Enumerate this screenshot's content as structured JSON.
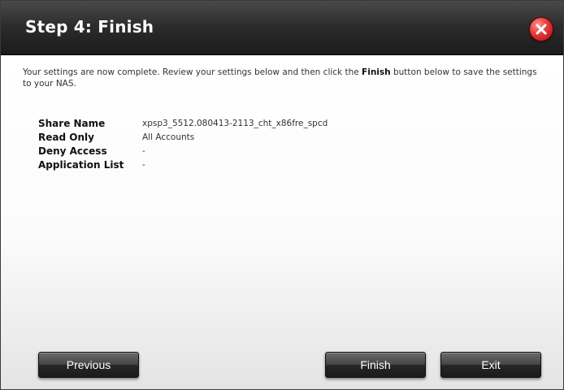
{
  "dialog": {
    "title": "Step 4: Finish",
    "close_icon": "close-icon",
    "close_color": "#e23a3a"
  },
  "intro": {
    "before": "Your settings are now complete. Review your settings below and then click the ",
    "bold": "Finish",
    "after": " button below to save the settings to your NAS."
  },
  "summary": [
    {
      "label": "Share Name",
      "value": "xpsp3_5512.080413-2113_cht_x86fre_spcd"
    },
    {
      "label": "Read Only",
      "value": "All Accounts"
    },
    {
      "label": "Deny Access",
      "value": "-"
    },
    {
      "label": "Application List",
      "value": "-"
    }
  ],
  "buttons": {
    "previous": "Previous",
    "finish": "Finish",
    "exit": "Exit"
  }
}
